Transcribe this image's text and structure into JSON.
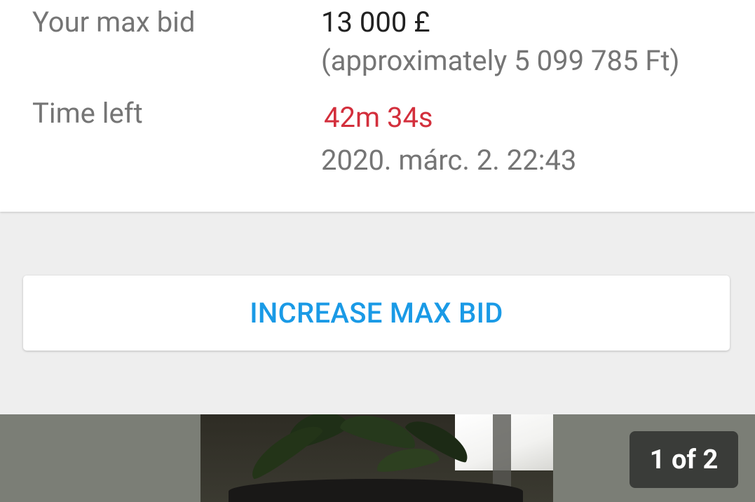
{
  "bid_details": {
    "max_bid_label": "Your max bid",
    "max_bid_value": "13 000 £",
    "max_bid_approx": "(approximately 5 099 785 Ft)",
    "time_left_label": "Time left",
    "time_left_value": "42m 34s",
    "end_date": "2020. márc. 2. 22:43"
  },
  "actions": {
    "increase_max_bid_label": "INCREASE MAX BID"
  },
  "gallery": {
    "image_counter": "1 of 2",
    "current_index": 1,
    "total": 2
  },
  "colors": {
    "accent_blue": "#1a9ae6",
    "time_left_red": "#d32f3c",
    "label_grey": "#757575",
    "value_dark": "#212121"
  }
}
